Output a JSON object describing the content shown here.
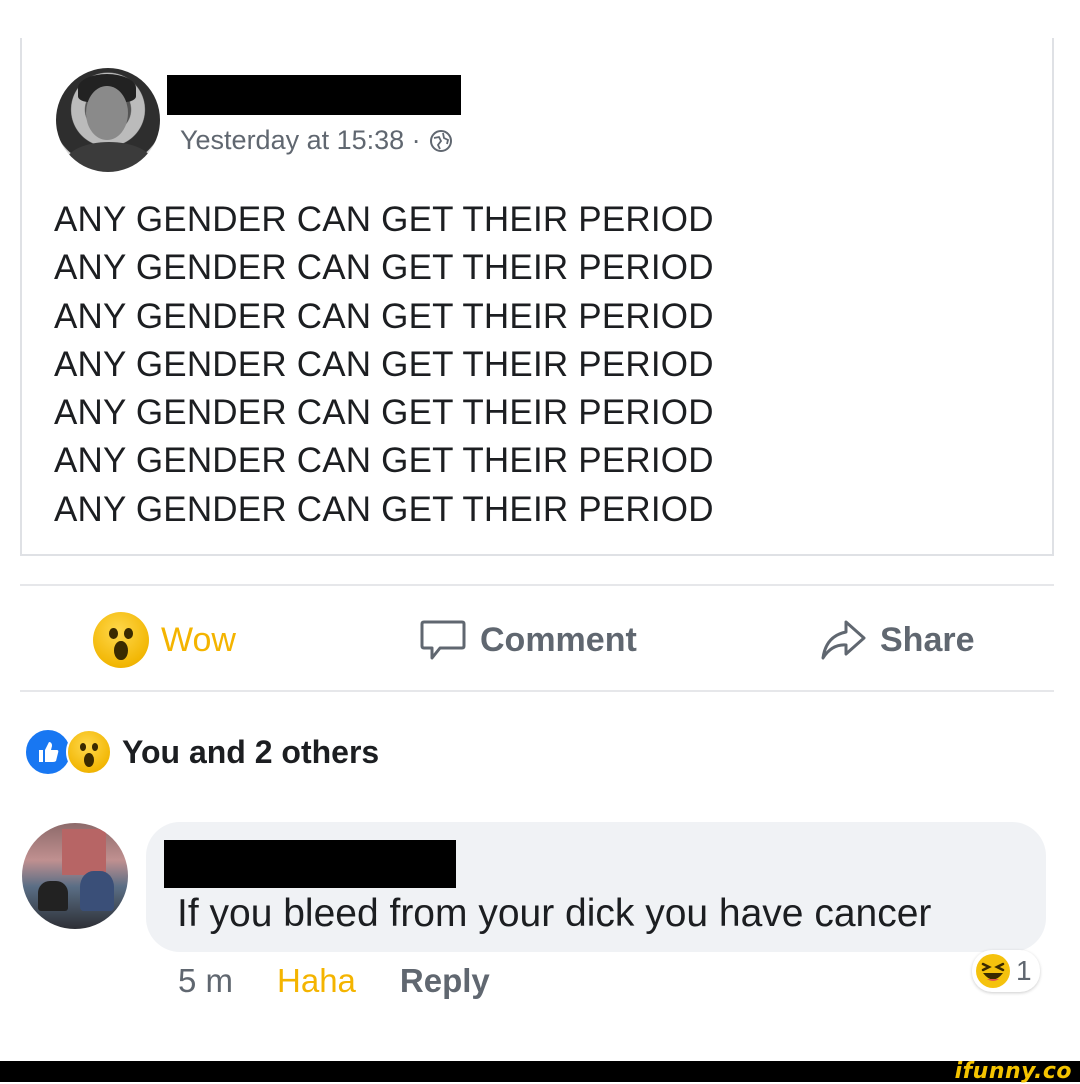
{
  "post": {
    "timestamp": "Yesterday at 15:38 · ",
    "privacy_icon": "globe-icon",
    "lines": [
      "ANY GENDER CAN GET THEIR PERIOD",
      "ANY GENDER CAN GET THEIR PERIOD",
      "ANY GENDER CAN GET THEIR PERIOD",
      "ANY GENDER CAN GET THEIR PERIOD",
      "ANY GENDER CAN GET THEIR PERIOD",
      "ANY GENDER CAN GET THEIR PERIOD",
      "ANY GENDER CAN GET THEIR PERIOD"
    ]
  },
  "actions": {
    "wow_label": "Wow",
    "comment_label": "Comment",
    "share_label": "Share"
  },
  "reactions": {
    "icons": [
      "like-icon",
      "wow-icon"
    ],
    "summary": "You and 2 others"
  },
  "comment": {
    "text": "If you bleed from your dick you have cancer",
    "time": "5 m",
    "haha_label": "Haha",
    "reply_label": "Reply",
    "reaction_icon": "haha-icon",
    "reaction_count": "1"
  },
  "watermark": "ifunny.co",
  "colors": {
    "wow_yellow": "#f4b400",
    "like_blue": "#1877f2",
    "meta_gray": "#606770",
    "bubble_bg": "#f0f2f5"
  }
}
